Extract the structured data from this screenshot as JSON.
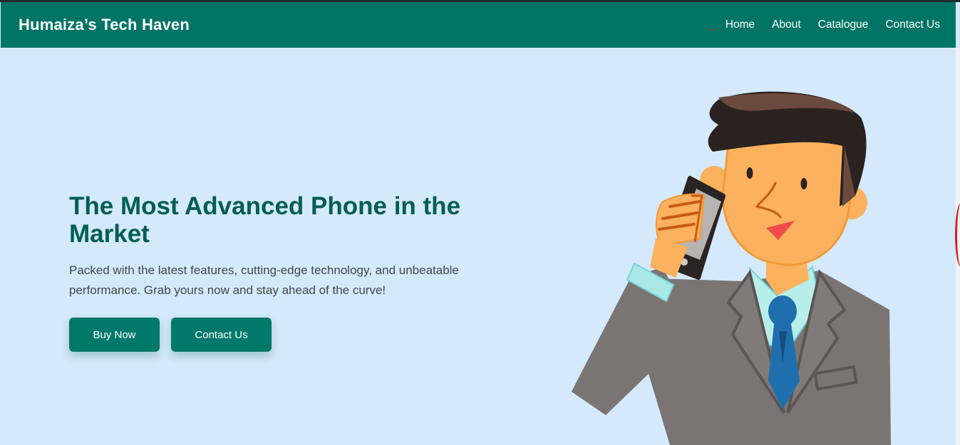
{
  "navbar": {
    "brand": "Humaiza’s Tech Haven",
    "links": [
      "Home",
      "About",
      "Catalogue",
      "Contact Us"
    ]
  },
  "hero": {
    "title": "The Most Advanced Phone in the Market",
    "subtitle": "Packed with the latest features, cutting-edge technology, and unbeatable performance. Grab yours now and stay ahead of the curve!",
    "buttons": {
      "buy": "Buy Now",
      "contact": "Contact Us"
    }
  },
  "illustration": {
    "icon": "businessman-on-phone-illustration"
  },
  "colors": {
    "navbar": "#007465",
    "background": "#d4e9fb",
    "title": "#005e52",
    "button": "#00786a"
  }
}
